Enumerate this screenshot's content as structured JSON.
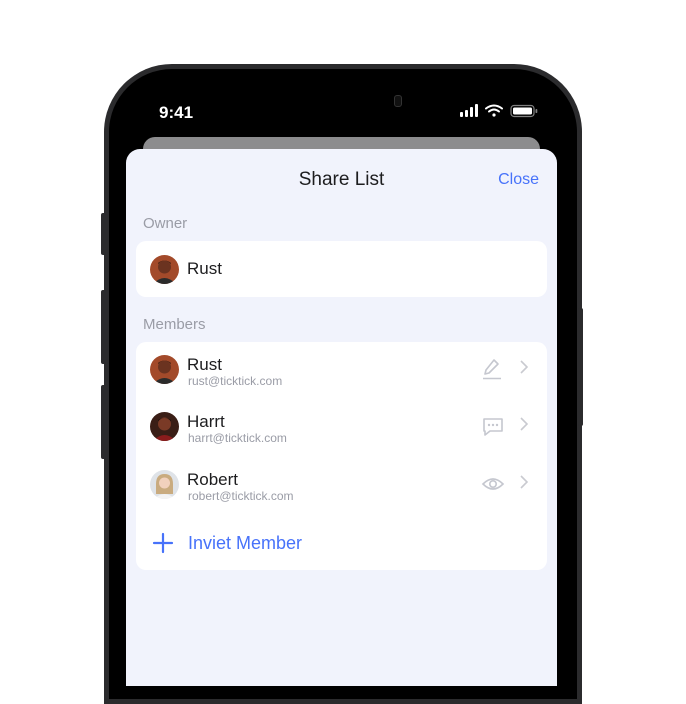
{
  "status_bar": {
    "time": "9:41"
  },
  "sheet": {
    "title": "Share List",
    "close_label": "Close"
  },
  "owner_section": {
    "label": "Owner",
    "name": "Rust"
  },
  "members_section": {
    "label": "Members",
    "members": [
      {
        "name": "Rust",
        "email": "rust@ticktick.com",
        "permission_icon": "pencil-icon"
      },
      {
        "name": "Harrt",
        "email": "harrt@ticktick.com",
        "permission_icon": "comment-icon"
      },
      {
        "name": "Robert",
        "email": "robert@ticktick.com",
        "permission_icon": "eye-icon"
      }
    ],
    "invite_label": "Inviet Member"
  },
  "colors": {
    "accent": "#4772fa",
    "sheet_bg": "#f1f3fc",
    "muted": "#9a9ca6"
  }
}
